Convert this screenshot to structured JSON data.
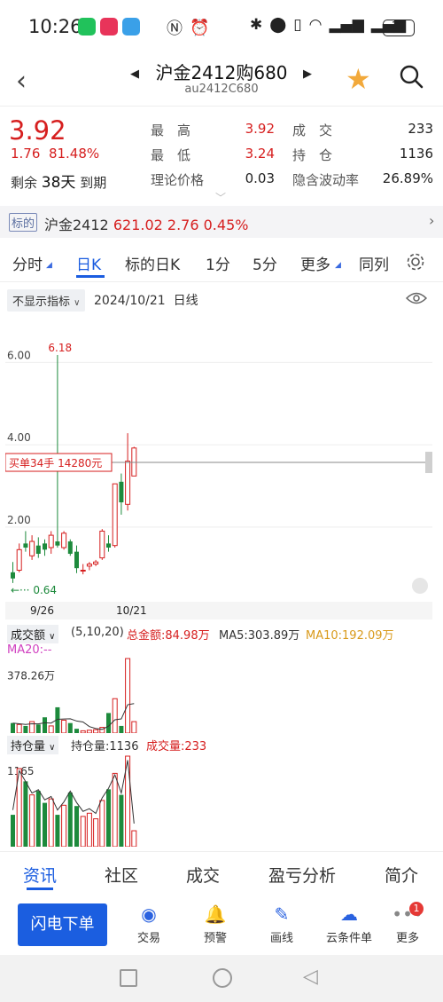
{
  "status": {
    "time": "10:26",
    "battery": "32"
  },
  "header": {
    "title": "沪金2412购680",
    "subtitle": "au2412C680"
  },
  "quote": {
    "price": "3.92",
    "change": "1.76",
    "change_pct": "81.48%",
    "remain_label": "剩余",
    "remain_days": "38天",
    "expiry_label": "到期",
    "high_label": "最　高",
    "high": "3.92",
    "low_label": "最　低",
    "low": "3.24",
    "theory_label": "理论价格",
    "theory": "0.03",
    "volume_label": "成　交",
    "volume": "233",
    "oi_label": "持　仓",
    "oi": "1136",
    "iv_label": "隐含波动率",
    "iv": "26.89%"
  },
  "underlying": {
    "badge": "标的",
    "name": "沪金2412",
    "price": "621.02",
    "change": "2.76",
    "pct": "0.45%"
  },
  "tabs": [
    "分时",
    "日K",
    "标的日K",
    "1分",
    "5分",
    "更多",
    "同列"
  ],
  "chart_bar": {
    "indicator": "不显示指标",
    "date": "2024/10/21",
    "period": "日线"
  },
  "chart_data": {
    "type": "candlestick",
    "y_ticks": [
      "6.00",
      "4.00",
      "2.00"
    ],
    "ylim": [
      0.4,
      7.0
    ],
    "max_label": "6.18",
    "min_label": "0.64",
    "order_label": "买单34手  14280元",
    "order_price": 3.57,
    "x_ticks": [
      "9/26",
      "10/21"
    ],
    "candles": [
      {
        "o": 0.9,
        "h": 1.15,
        "l": 0.64,
        "c": 0.75
      },
      {
        "o": 0.95,
        "h": 1.6,
        "l": 0.9,
        "c": 1.45
      },
      {
        "o": 1.6,
        "h": 1.9,
        "l": 1.4,
        "c": 1.5
      },
      {
        "o": 1.3,
        "h": 1.8,
        "l": 1.2,
        "c": 1.65
      },
      {
        "o": 1.55,
        "h": 1.75,
        "l": 1.25,
        "c": 1.35
      },
      {
        "o": 1.6,
        "h": 1.7,
        "l": 1.3,
        "c": 1.45
      },
      {
        "o": 1.5,
        "h": 1.9,
        "l": 1.35,
        "c": 1.8
      },
      {
        "o": 1.65,
        "h": 6.18,
        "l": 1.5,
        "c": 1.55
      },
      {
        "o": 1.5,
        "h": 1.9,
        "l": 1.45,
        "c": 1.85
      },
      {
        "o": 1.65,
        "h": 1.7,
        "l": 1.3,
        "c": 1.35
      },
      {
        "o": 1.4,
        "h": 1.55,
        "l": 0.88,
        "c": 1.0
      },
      {
        "o": 0.95,
        "h": 1.1,
        "l": 0.85,
        "c": 0.95
      },
      {
        "o": 1.05,
        "h": 1.15,
        "l": 0.95,
        "c": 1.1
      },
      {
        "o": 1.1,
        "h": 1.2,
        "l": 1.05,
        "c": 1.15
      },
      {
        "o": 1.25,
        "h": 1.95,
        "l": 1.2,
        "c": 1.9
      },
      {
        "o": 1.6,
        "h": 1.8,
        "l": 1.4,
        "c": 1.5
      },
      {
        "o": 1.55,
        "h": 2.1,
        "l": 1.5,
        "c": 3.05
      },
      {
        "o": 3.1,
        "h": 3.3,
        "l": 2.3,
        "c": 2.6
      },
      {
        "o": 2.55,
        "h": 4.28,
        "l": 2.4,
        "c": 3.6
      },
      {
        "o": 3.24,
        "h": 3.95,
        "l": 3.24,
        "c": 3.92
      }
    ],
    "volume": [
      35,
      30,
      25,
      40,
      30,
      55,
      25,
      90,
      45,
      35,
      15,
      8,
      10,
      12,
      20,
      70,
      120,
      25,
      260,
      40
    ],
    "open_interest": [
      400,
      980,
      820,
      650,
      700,
      550,
      600,
      400,
      520,
      680,
      510,
      380,
      420,
      350,
      580,
      720,
      920,
      650,
      1136,
      200
    ]
  },
  "volume_panel": {
    "label": "成交额",
    "params": "(5,10,20)",
    "total": "总金额:84.98万",
    "ma5": "MA5:303.89万",
    "ma10": "MA10:192.09万",
    "ma20": "MA20:--",
    "tick": "378.26万"
  },
  "oi_panel": {
    "label": "持仓量",
    "oi": "持仓量:1136",
    "vol": "成交量:233",
    "tick": "1165"
  },
  "bottom_tabs": [
    "资讯",
    "社区",
    "成交",
    "盈亏分析",
    "简介"
  ],
  "toolbar": {
    "flash": "闪电下单",
    "items": [
      "交易",
      "预警",
      "画线",
      "云条件单",
      "更多"
    ],
    "badge": "1"
  },
  "colors": {
    "up": "#d61f1f",
    "down": "#1d8a3c",
    "accent": "#1a5ce0"
  }
}
